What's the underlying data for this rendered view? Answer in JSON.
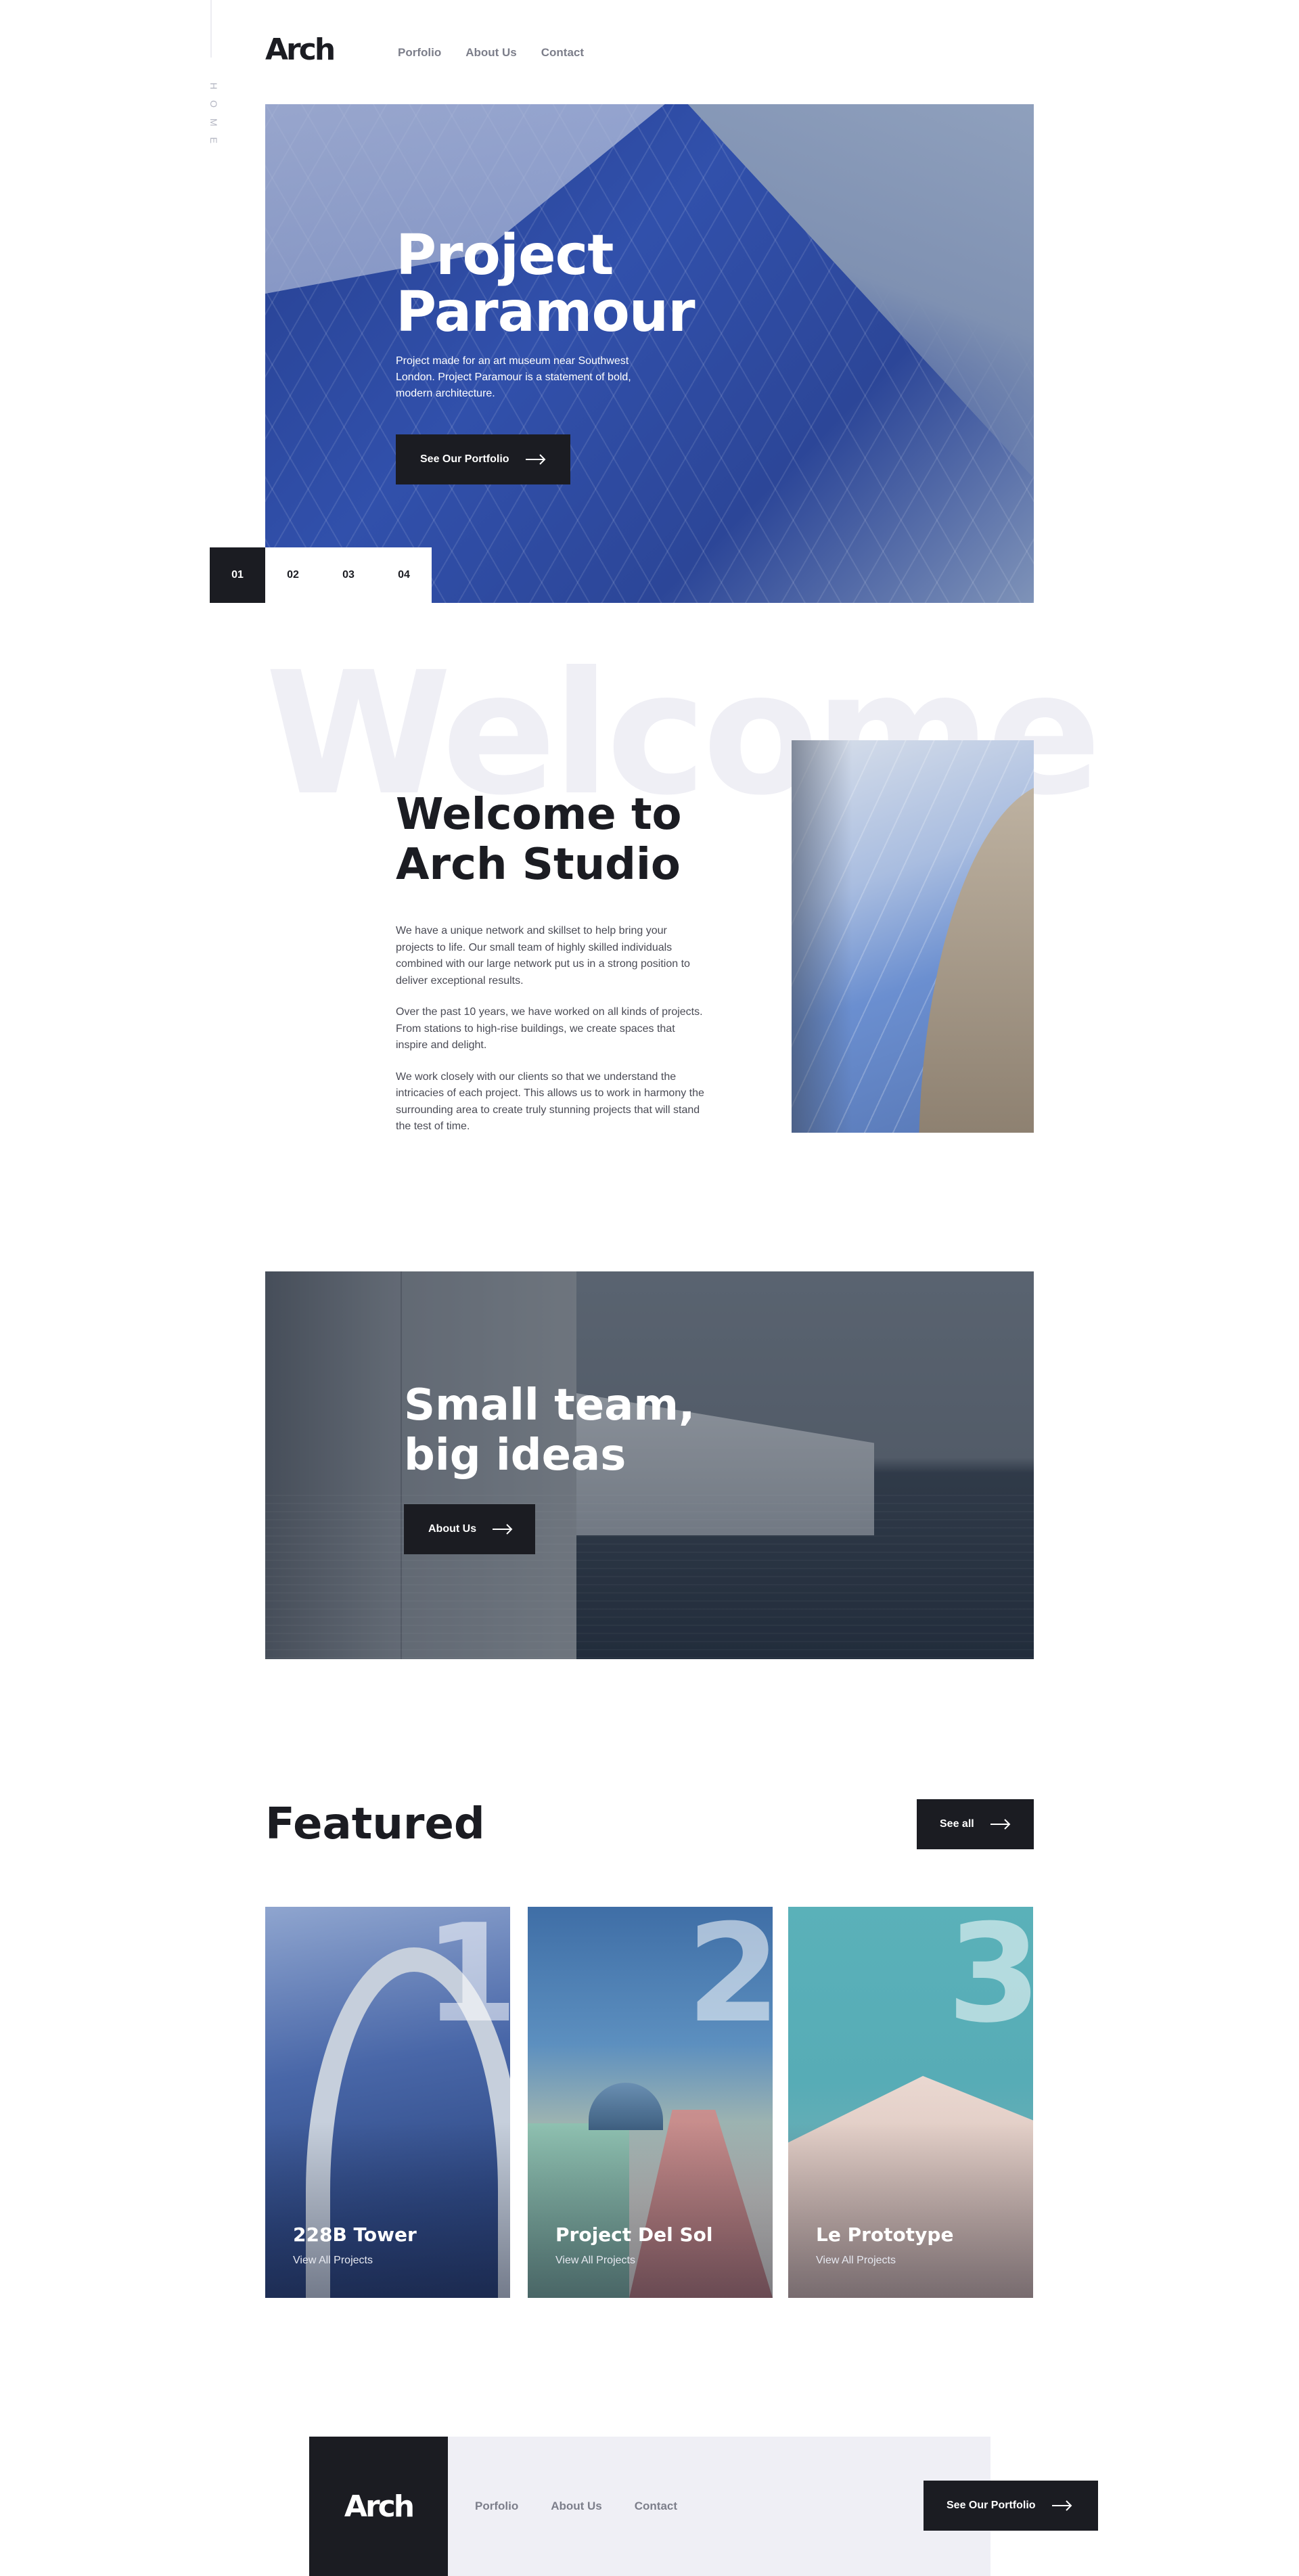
{
  "brand": {
    "logo": "Arch"
  },
  "side_label": "HOME",
  "nav": {
    "items": [
      "Porfolio",
      "About Us",
      "Contact"
    ]
  },
  "hero": {
    "title_line1": "Project",
    "title_line2": "Paramour",
    "text": "Project made for an art museum near Southwest London. Project Paramour is a statement of bold, modern architecture.",
    "button": "See Our Portfolio",
    "slides": [
      "01",
      "02",
      "03",
      "04"
    ],
    "active_slide": "01"
  },
  "welcome": {
    "bg_word": "Welcome",
    "title_line1": "Welcome to",
    "title_line2": "Arch Studio",
    "paragraphs": [
      "We have a unique network and skillset to help bring your projects to life. Our small team of highly skilled individuals combined with our large network put us in a strong position to deliver exceptional results.",
      "Over the past 10 years, we have worked on all kinds of projects. From stations to high-rise buildings, we create spaces that inspire and delight.",
      "We work closely with our clients so that we understand the intricacies of each project. This allows us to work in harmony the surrounding area to create truly stunning projects that will stand the test of time."
    ]
  },
  "team": {
    "title_line1": "Small team,",
    "title_line2": "big ideas",
    "button": "About Us"
  },
  "featured": {
    "title": "Featured",
    "see_all": "See all",
    "cards": [
      {
        "number": "1",
        "name": "228B Tower",
        "link": "View All Projects"
      },
      {
        "number": "2",
        "name": "Project Del Sol",
        "link": "View All Projects"
      },
      {
        "number": "3",
        "name": "Le Prototype",
        "link": "View All Projects"
      }
    ]
  },
  "footer": {
    "logo": "Arch",
    "nav": [
      "Porfolio",
      "About Us",
      "Contact"
    ],
    "button": "See Our Portfolio"
  },
  "colors": {
    "dark": "#1b1c22",
    "light_bg": "#efeff5",
    "nav_text": "#7c7e8a",
    "body_text": "#4a4b55"
  }
}
